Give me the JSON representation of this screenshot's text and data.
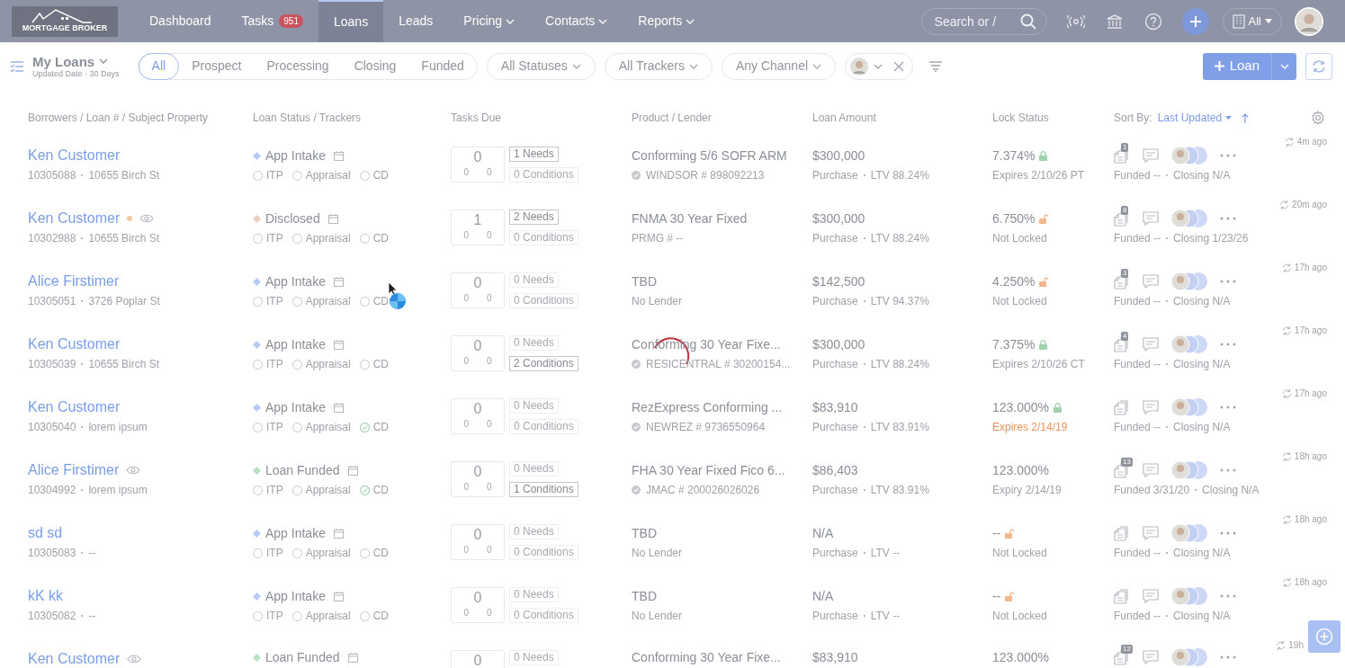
{
  "header": {
    "logo": "MORTGAGE BROKER",
    "nav": [
      {
        "label": "Dashboard",
        "selected": false
      },
      {
        "label": "Tasks",
        "badge": "951",
        "selected": false
      },
      {
        "label": "Loans",
        "selected": true
      },
      {
        "label": "Leads",
        "selected": false
      },
      {
        "label": "Pricing",
        "dropdown": true,
        "selected": false
      },
      {
        "label": "Contacts",
        "dropdown": true,
        "selected": false
      },
      {
        "label": "Reports",
        "dropdown": true,
        "selected": false
      }
    ],
    "search": {
      "placeholder": "Search or /"
    },
    "scope": "All"
  },
  "toolbar": {
    "title": "My Loans",
    "subtitle": "Updated Date · 30 Days",
    "stages": [
      {
        "label": "All",
        "selected": true
      },
      {
        "label": "Prospect",
        "selected": false
      },
      {
        "label": "Processing",
        "selected": false
      },
      {
        "label": "Closing",
        "selected": false
      },
      {
        "label": "Funded",
        "selected": false
      }
    ],
    "filters": [
      "All Statuses",
      "All Trackers",
      "Any Channel"
    ],
    "new_button": "Loan"
  },
  "table": {
    "columns": [
      "Borrowers / Loan # / Subject Property",
      "Loan Status / Trackers",
      "Tasks Due",
      "Product / Lender",
      "Loan Amount",
      "Lock Status"
    ],
    "sort_label": "Sort By:",
    "sort_value": "Last Updated",
    "rows": [
      {
        "kind": "full",
        "name": "Ken Customer",
        "watched": false,
        "loan_no": "10305088",
        "address": "10655 Birch St",
        "status": {
          "label": "App Intake",
          "color": "#b6caf4"
        },
        "trackers": [
          {
            "label": "ITP",
            "checked": false
          },
          {
            "label": "Appraisal",
            "checked": false
          },
          {
            "label": "CD",
            "checked": false
          }
        ],
        "tasks": {
          "total": "0",
          "a": "0",
          "b": "0"
        },
        "needs": "1 Needs",
        "needs_active": true,
        "conditions": "0 Conditions",
        "conditions_active": false,
        "product": "Conforming 5/6 SOFR ARM",
        "lender": "WINDSOR # 898092213",
        "lender_verified": true,
        "amount": "$300,000",
        "purpose": "Purchase",
        "ltv": "LTV 88.24%",
        "rate": "7.374%",
        "locked": true,
        "lock_note": "Expires 2/10/26 PT",
        "lock_warning": false,
        "docs": "1",
        "funded": "Funded --",
        "closing": "Closing N/A",
        "updated": "4m ago"
      },
      {
        "kind": "full",
        "name": "Ken Customer",
        "color": "#f4c8a6",
        "watched": true,
        "loan_no": "10302988",
        "address": "10655 Birch St",
        "status": {
          "label": "Disclosed",
          "color": "#e6d3bd"
        },
        "trackers": [
          {
            "label": "ITP",
            "checked": false
          },
          {
            "label": "Appraisal",
            "checked": false
          },
          {
            "label": "CD",
            "checked": false
          }
        ],
        "tasks": {
          "total": "1",
          "a": "0",
          "b": "0"
        },
        "needs": "2 Needs",
        "needs_active": true,
        "conditions": "0 Conditions",
        "conditions_active": false,
        "product": "FNMA 30 Year Fixed",
        "lender": "PRMG # --",
        "lender_verified": false,
        "amount": "$300,000",
        "purpose": "Purchase",
        "ltv": "LTV 88.24%",
        "rate": "6.750%",
        "locked": false,
        "lock_note": "Not Locked",
        "lock_warning": false,
        "docs": "8",
        "funded": "Funded --",
        "closing": "Closing 1/23/26",
        "updated": "20m ago"
      },
      {
        "kind": "full",
        "name": "Alice Firstimer",
        "watched": false,
        "loan_no": "10305051",
        "address": "3726 Poplar St",
        "status": {
          "label": "App Intake",
          "color": "#b6caf4"
        },
        "trackers": [
          {
            "label": "ITP",
            "checked": false
          },
          {
            "label": "Appraisal",
            "checked": false
          },
          {
            "label": "CD",
            "checked": false
          }
        ],
        "tasks": {
          "total": "0",
          "a": "0",
          "b": "0"
        },
        "needs": "0 Needs",
        "needs_active": false,
        "conditions": "0 Conditions",
        "conditions_active": false,
        "product": "TBD",
        "lender": "No Lender",
        "lender_verified": false,
        "amount": "$142,500",
        "purpose": "Purchase",
        "ltv": "LTV 94.37%",
        "rate": "4.250%",
        "locked": false,
        "lock_note": "Not Locked",
        "lock_warning": false,
        "docs": "3",
        "funded": "Funded --",
        "closing": "Closing N/A",
        "updated": "17h ago"
      },
      {
        "kind": "full",
        "name": "Ken Customer",
        "watched": false,
        "loan_no": "10305039",
        "address": "10655 Birch St",
        "status": {
          "label": "App Intake",
          "color": "#b6caf4"
        },
        "trackers": [
          {
            "label": "ITP",
            "checked": false
          },
          {
            "label": "Appraisal",
            "checked": false
          },
          {
            "label": "CD",
            "checked": false
          }
        ],
        "tasks": {
          "total": "0",
          "a": "0",
          "b": "0"
        },
        "needs": "0 Needs",
        "needs_active": false,
        "conditions": "2 Conditions",
        "conditions_active": true,
        "product": "Conforming 30 Year Fixe...",
        "lender": "RESICENTRAL # 30200154...",
        "lender_verified": true,
        "amount": "$300,000",
        "purpose": "Purchase",
        "ltv": "LTV 88.24%",
        "rate": "7.375%",
        "locked": true,
        "lock_note": "Expires 2/10/26 CT",
        "lock_warning": false,
        "docs": "4",
        "funded": "Funded --",
        "closing": "Closing N/A",
        "updated": "17h ago"
      },
      {
        "kind": "full",
        "name": "Ken Customer",
        "watched": false,
        "loan_no": "10305040",
        "address": "lorem ipsum",
        "status": {
          "label": "App Intake",
          "color": "#b6caf4"
        },
        "trackers": [
          {
            "label": "ITP",
            "checked": false
          },
          {
            "label": "Appraisal",
            "checked": false
          },
          {
            "label": "CD",
            "checked": true
          }
        ],
        "tasks": {
          "total": "0",
          "a": "0",
          "b": "0"
        },
        "needs": "0 Needs",
        "needs_active": false,
        "conditions": "0 Conditions",
        "conditions_active": false,
        "product": "RezExpress Conforming ...",
        "lender": "NEWREZ # 9736550964",
        "lender_verified": true,
        "amount": "$83,910",
        "purpose": "Purchase",
        "ltv": "LTV 83.91%",
        "rate": "123.000%",
        "locked": true,
        "lock_note": "Expires 2/14/19",
        "lock_warning": true,
        "funded": "Funded --",
        "closing": "Closing N/A",
        "updated": "17h ago"
      },
      {
        "kind": "full",
        "name": "Alice Firstimer",
        "watched": true,
        "loan_no": "10304992",
        "address": "lorem ipsum",
        "status": {
          "label": "Loan Funded",
          "color": "#b8e2c4"
        },
        "trackers": [
          {
            "label": "ITP",
            "checked": false
          },
          {
            "label": "Appraisal",
            "checked": false
          },
          {
            "label": "CD",
            "checked": true
          }
        ],
        "tasks": {
          "total": "0",
          "a": "0",
          "b": "0"
        },
        "needs": "0 Needs",
        "needs_active": false,
        "conditions": "1 Conditions",
        "conditions_active": true,
        "product": "FHA 30 Year Fixed Fico 6...",
        "lender": "JMAC # 200026026026",
        "lender_verified": true,
        "amount": "$86,403",
        "purpose": "Purchase",
        "ltv": "LTV 83.91%",
        "rate": "123.000%",
        "lock_note": "Expiry 2/14/19",
        "lock_warning": false,
        "docs": "13",
        "funded": "Funded 3/31/20",
        "closing": "Closing N/A",
        "updated": "18h ago"
      },
      {
        "kind": "full",
        "name": "sd sd",
        "watched": false,
        "loan_no": "10305083",
        "address": "--",
        "status": {
          "label": "App Intake",
          "color": "#b6caf4"
        },
        "trackers": [
          {
            "label": "ITP",
            "checked": false
          },
          {
            "label": "Appraisal",
            "checked": false
          },
          {
            "label": "CD",
            "checked": false
          }
        ],
        "tasks": {
          "total": "0",
          "a": "0",
          "b": "0"
        },
        "needs": "0 Needs",
        "needs_active": false,
        "conditions": "0 Conditions",
        "conditions_active": false,
        "product": "TBD",
        "lender": "No Lender",
        "lender_verified": false,
        "amount": "N/A",
        "purpose": "Purchase",
        "ltv": "LTV --",
        "rate": "--",
        "locked": false,
        "lock_note": "Not Locked",
        "lock_warning": false,
        "funded": "Funded --",
        "closing": "Closing N/A",
        "updated": "18h ago"
      },
      {
        "kind": "full",
        "name": "kK kk",
        "watched": false,
        "loan_no": "10305082",
        "address": "--",
        "status": {
          "label": "App Intake",
          "color": "#b6caf4"
        },
        "trackers": [
          {
            "label": "ITP",
            "checked": false
          },
          {
            "label": "Appraisal",
            "checked": false
          },
          {
            "label": "CD",
            "checked": false
          }
        ],
        "tasks": {
          "total": "0",
          "a": "0",
          "b": "0"
        },
        "needs": "0 Needs",
        "needs_active": false,
        "conditions": "0 Conditions",
        "conditions_active": false,
        "product": "TBD",
        "lender": "No Lender",
        "lender_verified": false,
        "amount": "N/A",
        "purpose": "Purchase",
        "ltv": "LTV --",
        "rate": "--",
        "locked": false,
        "lock_note": "Not Locked",
        "lock_warning": false,
        "funded": "Funded --",
        "closing": "Closing N/A",
        "updated": "18h ago"
      },
      {
        "kind": "partial",
        "name": "Ken Customer",
        "watched": true,
        "status": {
          "label": "Loan Funded",
          "color": "#b8e2c4"
        },
        "tasks": {
          "total": "0"
        },
        "needs": "0 Needs",
        "needs_active": false,
        "product": "Conforming 30 Year Fixe...",
        "amount": "$83,910",
        "rate": "123.000%",
        "docs": "12",
        "updated": "19h"
      }
    ]
  }
}
